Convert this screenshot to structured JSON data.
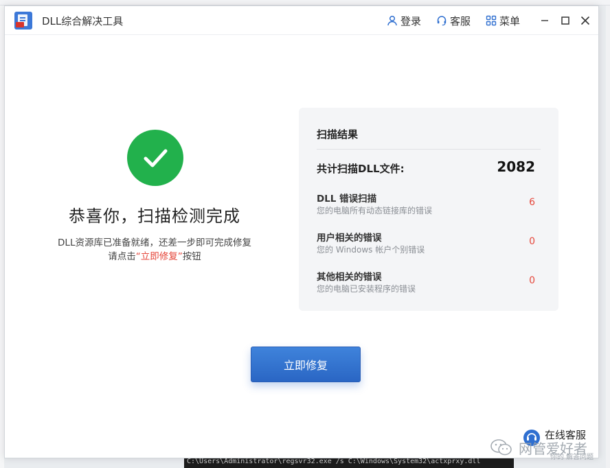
{
  "app": {
    "title": "DLL综合解决工具"
  },
  "titlebar": {
    "login_label": "登录",
    "service_label": "客服",
    "menu_label": "菜单"
  },
  "success": {
    "title": "恭喜你，扫描检测完成",
    "desc_line1": "DLL资源库已准备就绪，还差一步即可完成修复",
    "desc_line2_prefix": "请点击",
    "desc_line2_highlight": "“立即修复”",
    "desc_line2_suffix": "按钮"
  },
  "scan_result": {
    "title": "扫描结果",
    "total_label": "共计扫描DLL文件:",
    "total_value": "2082",
    "rows": [
      {
        "title": "DLL 错误扫描",
        "sub": "您的电脑所有动态链接库的错误",
        "value": "6"
      },
      {
        "title": "用户相关的错误",
        "sub": "您的 Windows 帐户个别错误",
        "value": "0"
      },
      {
        "title": "其他相关的错误",
        "sub": "您的电脑已安装程序的错误",
        "value": "0"
      }
    ]
  },
  "fix_button": {
    "label": "立即修复"
  },
  "online_support": {
    "label": "在线客服"
  },
  "watermark": {
    "text": "网管爱好者",
    "sub": "你的 解答问题"
  },
  "background": {
    "terminal_text": "C:\\Users\\Administrator\\regsvr32.exe /s C:\\Windows\\System32\\actxprxy.dll"
  },
  "colors": {
    "accent": "#2f6fd0",
    "success": "#22b14c",
    "error": "#e5463a"
  }
}
